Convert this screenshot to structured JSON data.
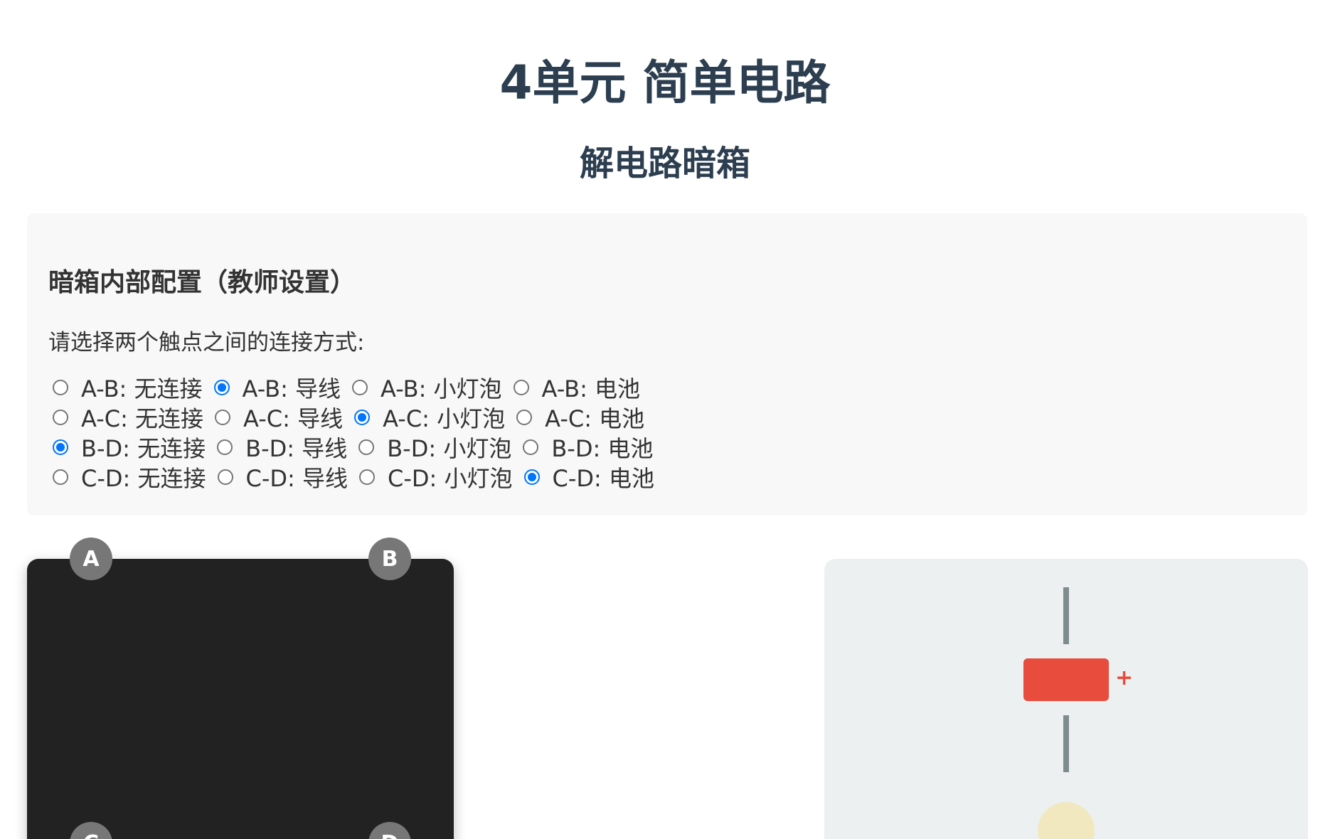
{
  "header": {
    "title": "4单元 简单电路",
    "subtitle": "解电路暗箱"
  },
  "config": {
    "heading": "暗箱内部配置（教师设置）",
    "instruction": "请选择两个触点之间的连接方式:",
    "rows": [
      {
        "pair": "A-B",
        "options": [
          {
            "label": "A-B: 无连接",
            "checked": false
          },
          {
            "label": "A-B: 导线",
            "checked": true
          },
          {
            "label": "A-B: 小灯泡",
            "checked": false
          },
          {
            "label": "A-B: 电池",
            "checked": false
          }
        ]
      },
      {
        "pair": "A-C",
        "options": [
          {
            "label": "A-C: 无连接",
            "checked": false
          },
          {
            "label": "A-C: 导线",
            "checked": false
          },
          {
            "label": "A-C: 小灯泡",
            "checked": true
          },
          {
            "label": "A-C: 电池",
            "checked": false
          }
        ]
      },
      {
        "pair": "B-D",
        "options": [
          {
            "label": "B-D: 无连接",
            "checked": true
          },
          {
            "label": "B-D: 导线",
            "checked": false
          },
          {
            "label": "B-D: 小灯泡",
            "checked": false
          },
          {
            "label": "B-D: 电池",
            "checked": false
          }
        ]
      },
      {
        "pair": "C-D",
        "options": [
          {
            "label": "C-D: 无连接",
            "checked": false
          },
          {
            "label": "C-D: 导线",
            "checked": false
          },
          {
            "label": "C-D: 小灯泡",
            "checked": false
          },
          {
            "label": "C-D: 电池",
            "checked": true
          }
        ]
      }
    ]
  },
  "blackbox": {
    "terminals": {
      "a": "A",
      "b": "B",
      "c": "C",
      "d": "D"
    }
  },
  "tester": {
    "battery_plus": "+"
  },
  "colors": {
    "title": "#2c3e50",
    "radio_checked": "#0075ff",
    "blackbox": "#222222",
    "terminal": "#777777",
    "battery": "#e74c3c",
    "wire": "#7f8c8d",
    "bulb": "#f2e8c0",
    "tester_bg": "#ecf0f1"
  }
}
